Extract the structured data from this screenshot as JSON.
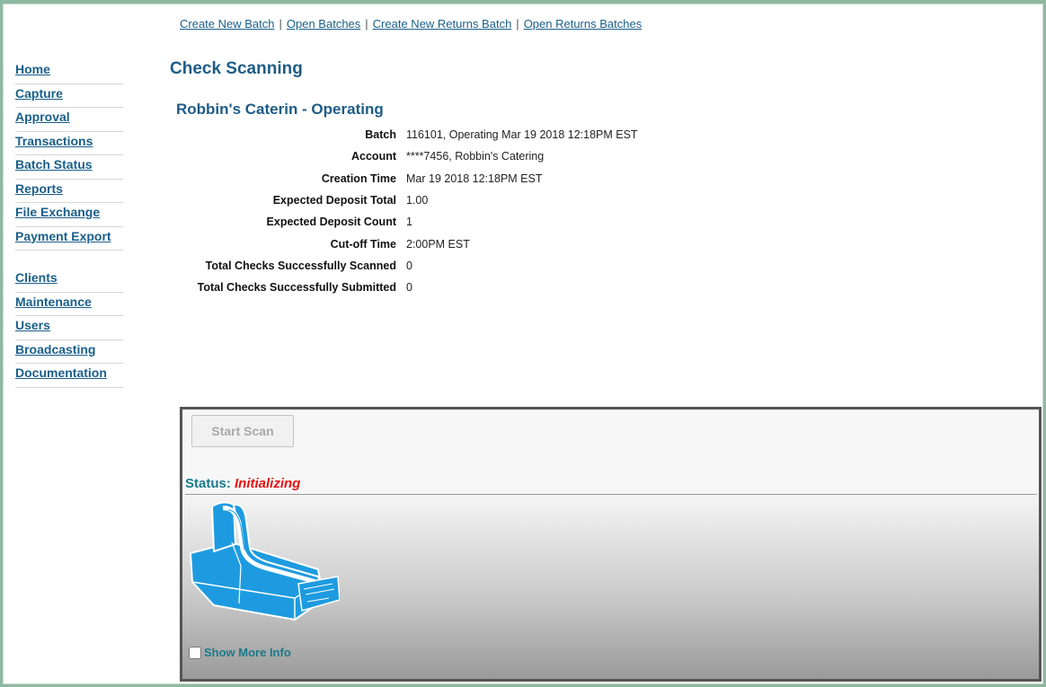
{
  "toplinks": [
    {
      "label": "Create New Batch"
    },
    {
      "label": "Open Batches"
    },
    {
      "label": "Create New Returns Batch"
    },
    {
      "label": "Open Returns Batches"
    }
  ],
  "separator": "|",
  "sidebar": {
    "group1": [
      {
        "label": "Home"
      },
      {
        "label": "Capture"
      },
      {
        "label": "Approval"
      },
      {
        "label": "Transactions"
      },
      {
        "label": "Batch Status"
      },
      {
        "label": "Reports"
      },
      {
        "label": "File Exchange"
      },
      {
        "label": "Payment Export"
      }
    ],
    "group2": [
      {
        "label": "Clients"
      },
      {
        "label": "Maintenance"
      },
      {
        "label": "Users"
      },
      {
        "label": "Broadcasting"
      },
      {
        "label": "Documentation"
      }
    ]
  },
  "page_title": "Check Scanning",
  "batch_title": "Robbin's Caterin - Operating",
  "info_rows": [
    {
      "label": "Batch",
      "value": "116101, Operating Mar 19 2018 12:18PM EST"
    },
    {
      "label": "Account",
      "value": "****7456, Robbin's Catering"
    },
    {
      "label": "Creation Time",
      "value": "Mar 19 2018 12:18PM EST"
    },
    {
      "label": "Expected Deposit Total",
      "value": "1.00"
    },
    {
      "label": "Expected Deposit Count",
      "value": "1"
    },
    {
      "label": "Cut-off Time",
      "value": "2:00PM EST"
    },
    {
      "label": "Total Checks Successfully Scanned",
      "value": "0"
    },
    {
      "label": "Total Checks Successfully Submitted",
      "value": "0"
    }
  ],
  "scanner": {
    "start_scan_label": "Start Scan",
    "status_label": "Status:",
    "status_value": "Initializing",
    "show_more_label": "Show More Info",
    "icon": "check-scanner-icon",
    "colors": {
      "scanner": "#1e9be0",
      "status_value": "#e81010",
      "status_label": "#1a7a8a"
    }
  }
}
